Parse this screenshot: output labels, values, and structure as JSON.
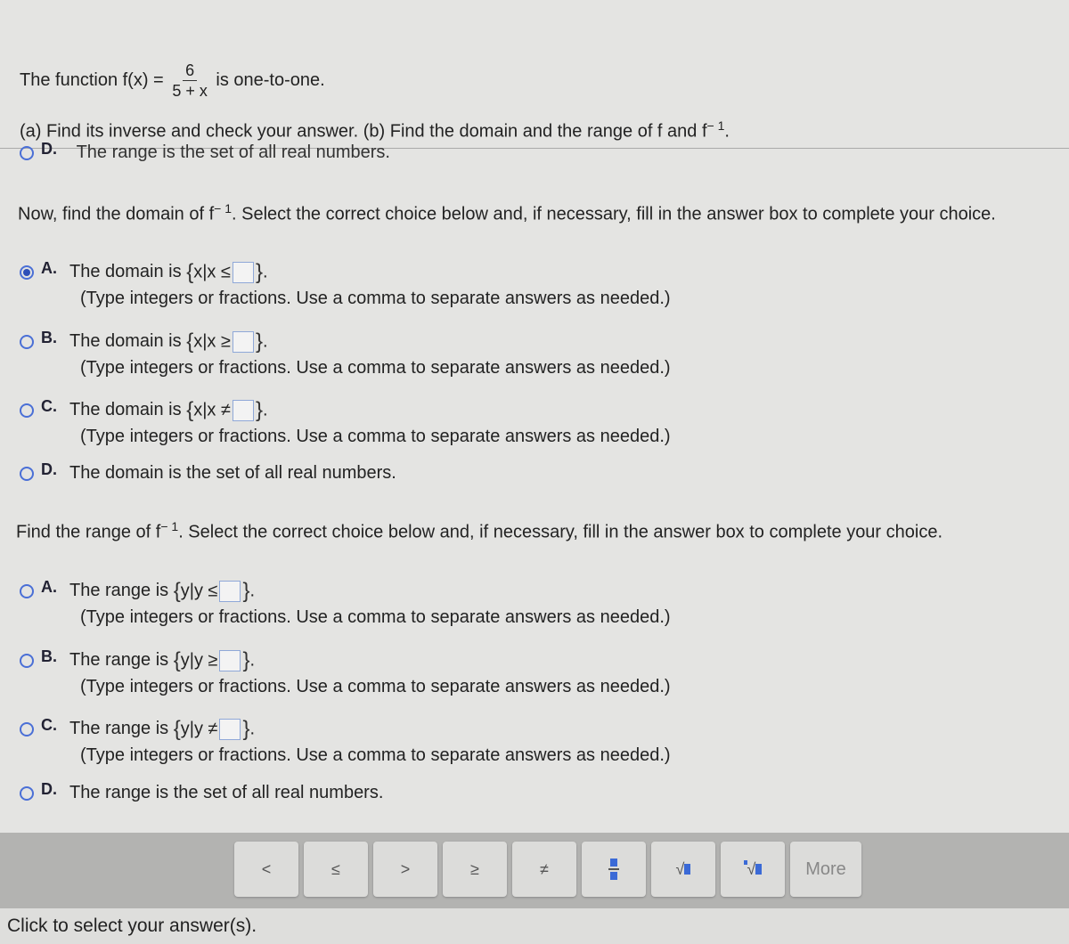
{
  "question": {
    "intro_prefix": "The function f(x) =",
    "numerator": "6",
    "denominator": "5 + x",
    "intro_suffix": "is one-to-one.",
    "parts": "(a) Find its inverse and check your answer. (b) Find the domain and the range of f and f",
    "superscript": "− 1",
    "period": "."
  },
  "cutoff_option": {
    "letter": "D.",
    "text": "The range is the set of all real numbers."
  },
  "domain": {
    "prompt_prefix": "Now, find the domain of f",
    "prompt_sup": "− 1",
    "prompt_suffix": ". Select the correct choice below and, if necessary, fill in the answer box to complete your choice.",
    "options": [
      {
        "letter": "A.",
        "text": "The domain is",
        "set": "x|x ≤",
        "hint": "(Type integers or fractions. Use a comma to separate answers as needed.)",
        "selected": true
      },
      {
        "letter": "B.",
        "text": "The domain is",
        "set": "x|x ≥",
        "hint": "(Type integers or fractions. Use a comma to separate answers as needed.)",
        "selected": false
      },
      {
        "letter": "C.",
        "text": "The domain is",
        "set": "x|x ≠",
        "hint": "(Type integers or fractions. Use a comma to separate answers as needed.)",
        "selected": false
      },
      {
        "letter": "D.",
        "text": "The domain is the set of all real numbers.",
        "selected": false
      }
    ]
  },
  "range": {
    "prompt_prefix": "Find the range of f",
    "prompt_sup": "− 1",
    "prompt_suffix": ". Select the correct choice below and, if necessary, fill in the answer box to complete your choice.",
    "options": [
      {
        "letter": "A.",
        "text": "The range is",
        "set": "y|y ≤",
        "hint": "(Type integers or fractions. Use a comma to separate answers as needed.)",
        "selected": false
      },
      {
        "letter": "B.",
        "text": "The range is",
        "set": "y|y ≥",
        "hint": "(Type integers or fractions. Use a comma to separate answers as needed.)",
        "selected": false
      },
      {
        "letter": "C.",
        "text": "The range is",
        "set": "y|y ≠",
        "hint": "(Type integers or fractions. Use a comma to separate answers as needed.)",
        "selected": false
      },
      {
        "letter": "D.",
        "text": "The range is the set of all real numbers.",
        "selected": false
      }
    ]
  },
  "toolbar": {
    "lt": "<",
    "le": "≤",
    "gt": ">",
    "ge": "≥",
    "ne": "≠",
    "more": "More",
    "accent": "#3b6ad6"
  },
  "footer": {
    "status": "Click to select your answer(s)."
  }
}
